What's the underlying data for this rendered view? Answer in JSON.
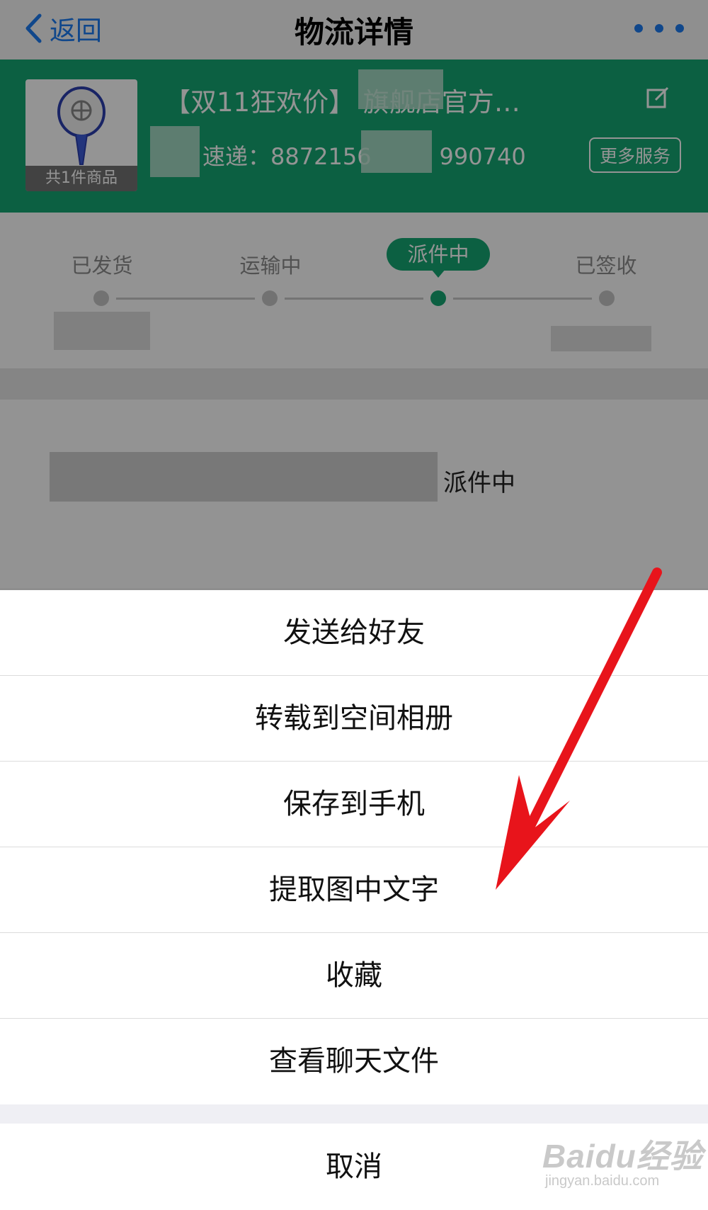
{
  "navbar": {
    "back_label": "返回",
    "title": "物流详情"
  },
  "order": {
    "title": "【双11狂欢价】       旗舰店官方…",
    "item_count_label": "共1件商品",
    "tracking_prefix": "速递：",
    "tracking_number_start": "8872156",
    "tracking_number_end": "990740",
    "more_service_label": "更多服务"
  },
  "progress": {
    "steps": [
      "已发货",
      "运输中",
      "派件中",
      "已签收"
    ],
    "active_step": "派件中",
    "latest_status": "派件中"
  },
  "action_sheet": {
    "items": [
      "发送给好友",
      "转载到空间相册",
      "保存到手机",
      "提取图中文字",
      "收藏",
      "查看聊天文件"
    ],
    "cancel_label": "取消"
  },
  "watermark": {
    "main": "Baidu经验",
    "sub": "jingyan.baidu.com"
  },
  "colors": {
    "accent_green": "#16a572",
    "link_blue": "#1d7bf0",
    "annotation_arrow": "#e8141b"
  }
}
